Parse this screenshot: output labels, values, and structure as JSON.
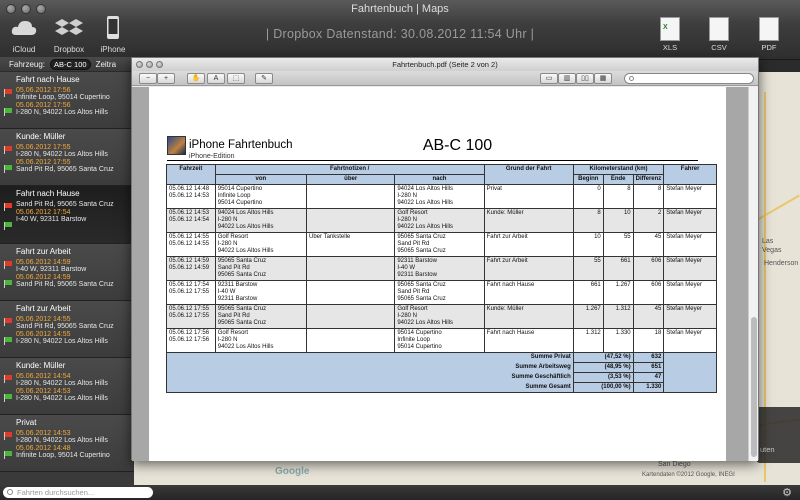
{
  "window": {
    "title": "Fahrtenbuch | Maps"
  },
  "toolbar": {
    "left": [
      {
        "label": "iCloud",
        "icon": "cloud-icon"
      },
      {
        "label": "Dropbox",
        "icon": "dropbox-icon"
      },
      {
        "label": "iPhone",
        "icon": "iphone-icon"
      }
    ],
    "status": "| Dropbox Datenstand: 30.08.2012 11:54 Uhr |",
    "right": [
      {
        "label": "XLS",
        "icon": "xls-icon",
        "short": "X"
      },
      {
        "label": "CSV",
        "icon": "csv-icon",
        "short": ""
      },
      {
        "label": "PDF",
        "icon": "pdf-icon",
        "short": ""
      }
    ]
  },
  "filter": {
    "vehicle_label": "Fahrzeug:",
    "vehicle_value": "AB-C 100",
    "range_label": "Zeitra"
  },
  "trips": [
    {
      "title": "Fahrt nach Hause",
      "start_time": "05.06.2012 17:56",
      "start": "Infinite Loop, 95014 Cupertino",
      "end_time": "05.06.2012 17:56",
      "end": "I-280 N, 94022 Los Altos Hills",
      "selected": false
    },
    {
      "title": "Kunde: Müller",
      "start_time": "05.06.2012 17:55",
      "start": "I-280 N, 94022 Los Altos Hills",
      "end_time": "05.06.2012 17:55",
      "end": "Sand Pit Rd, 95065 Santa Cruz",
      "selected": false
    },
    {
      "title": "Fahrt nach Hause",
      "start_time": "",
      "start": "Sand Pit Rd, 95065 Santa Cruz",
      "end_time": "05.06.2012 17:54",
      "end": "I-40 W, 92311 Barstow",
      "selected": true
    },
    {
      "title": "Fahrt zur Arbeit",
      "start_time": "05.06.2012 14:59",
      "start": "I-40 W, 92311 Barstow",
      "end_time": "05.06.2012 14:59",
      "end": "Sand Pit Rd, 95065 Santa Cruz",
      "selected": false
    },
    {
      "title": "Fahrt zur Arbeit",
      "start_time": "05.06.2012 14:55",
      "start": "Sand Pit Rd, 95065 Santa Cruz",
      "end_time": "05.06.2012 14:55",
      "end": "I-280 N, 94022 Los Altos Hills",
      "selected": false
    },
    {
      "title": "Kunde: Müller",
      "start_time": "05.06.2012 14:54",
      "start": "I-280 N, 94022 Los Altos Hills",
      "end_time": "05.06.2012 14:53",
      "end": "I-280 N, 94022 Los Altos Hills",
      "selected": false
    },
    {
      "title": "Privat",
      "start_time": "05.06.2012 14:53",
      "start": "I-280 N, 94022 Los Altos Hills",
      "end_time": "05.06.2012 14:48",
      "end": "Infinite Loop, 95014 Cupertino",
      "selected": false
    }
  ],
  "search": {
    "placeholder": "Fahrten durchsuchen..."
  },
  "preview": {
    "title": "Fahrtenbuch.pdf (Seite 2 von 2)",
    "doc_title": "iPhone Fahrtenbuch",
    "doc_subtitle": "iPhone-Edition",
    "plate": "AB-C 100",
    "headers": {
      "fahrzeit": "Fahrzeit",
      "notizen": "Fahrtnotizen /",
      "von": "von",
      "ueber": "über",
      "nach": "nach",
      "grund": "Grund der Fahrt",
      "km": "Kilometerstand (km)",
      "beginn": "Beginn",
      "ende": "Ende",
      "diff": "Differenz",
      "fahrer": "Fahrer"
    },
    "rows": [
      {
        "t1": "05.06.12 14:48",
        "t2": "05.06.12 14:53",
        "von": [
          "95014 Cupertino",
          "Infinite Loop",
          "95014 Cupertino"
        ],
        "ueber": "",
        "nach": [
          "94024 Los Altos Hills",
          "I-280 N",
          "94022 Los Altos Hills"
        ],
        "grund": "Privat",
        "b": "0",
        "e": "8",
        "d": "8",
        "f": "Stefan Meyer"
      },
      {
        "t1": "05.06.12 14:53",
        "t2": "05.06.12 14:54",
        "von": [
          "94024 Los Altos Hills",
          "I-280 N",
          "94022 Los Altos Hills"
        ],
        "ueber": "",
        "nach": [
          "Golf Resort",
          "I-280 N",
          "94022 Los Altos Hills"
        ],
        "grund": "Kunde: Müller",
        "b": "8",
        "e": "10",
        "d": "2",
        "f": "Stefan Meyer"
      },
      {
        "t1": "05.06.12 14:55",
        "t2": "05.06.12 14:55",
        "von": [
          "Golf Resort",
          "I-280 N",
          "94022 Los Altos Hills"
        ],
        "ueber": "Über Tankstelle",
        "nach": [
          "95065 Santa Cruz",
          "Sand Pit Rd",
          "95065 Santa Cruz"
        ],
        "grund": "Fahrt zur Arbeit",
        "b": "10",
        "e": "55",
        "d": "45",
        "f": "Stefan Meyer"
      },
      {
        "t1": "05.06.12 14:59",
        "t2": "05.06.12 14:59",
        "von": [
          "95065 Santa Cruz",
          "Sand Pit Rd",
          "95065 Santa Cruz"
        ],
        "ueber": "",
        "nach": [
          "92311 Barstow",
          "I-40 W",
          "92311 Barstow"
        ],
        "grund": "Fahrt zur Arbeit",
        "b": "55",
        "e": "661",
        "d": "606",
        "f": "Stefan Meyer"
      },
      {
        "t1": "05.06.12 17:54",
        "t2": "05.06.12 17:55",
        "von": [
          "92311 Barstow",
          "I-40 W",
          "92311 Barstow"
        ],
        "ueber": "",
        "nach": [
          "95065 Santa Cruz",
          "Sand Pit Rd",
          "95065 Santa Cruz"
        ],
        "grund": "Fahrt nach Hause",
        "b": "661",
        "e": "1.267",
        "d": "606",
        "f": "Stefan Meyer"
      },
      {
        "t1": "05.06.12 17:55",
        "t2": "05.06.12 17:55",
        "von": [
          "95065 Santa Cruz",
          "Sand Pit Rd",
          "95065 Santa Cruz"
        ],
        "ueber": "",
        "nach": [
          "Golf Resort",
          "I-280 N",
          "94022 Los Altos Hills"
        ],
        "grund": "Kunde: Müller",
        "b": "1.267",
        "e": "1.312",
        "d": "45",
        "f": "Stefan Meyer"
      },
      {
        "t1": "05.06.12 17:56",
        "t2": "05.06.12 17:56",
        "von": [
          "Golf Resort",
          "I-280 N",
          "94022 Los Altos Hills"
        ],
        "ueber": "",
        "nach": [
          "95014 Cupertino",
          "Infinite Loop",
          "95014 Cupertino"
        ],
        "grund": "Fahrt nach Hause",
        "b": "1.312",
        "e": "1.330",
        "d": "18",
        "f": "Stefan Meyer"
      }
    ],
    "summary": [
      {
        "label": "Summe Privat",
        "pct": "(47,52 %)",
        "val": "632"
      },
      {
        "label": "Summe Arbeitsweg",
        "pct": "(48,95 %)",
        "val": "651"
      },
      {
        "label": "Summe Geschäftlich",
        "pct": "(3,53 %)",
        "val": "47"
      },
      {
        "label": "Summe Gesamt",
        "pct": "(100,00 %)",
        "val": "1.330"
      }
    ]
  },
  "map": {
    "labels": [
      "Las",
      "Vegas",
      "Henderson",
      "San Diego",
      "Kartendaten ©2012 Google, INEGI",
      "Google",
      "uten"
    ]
  }
}
